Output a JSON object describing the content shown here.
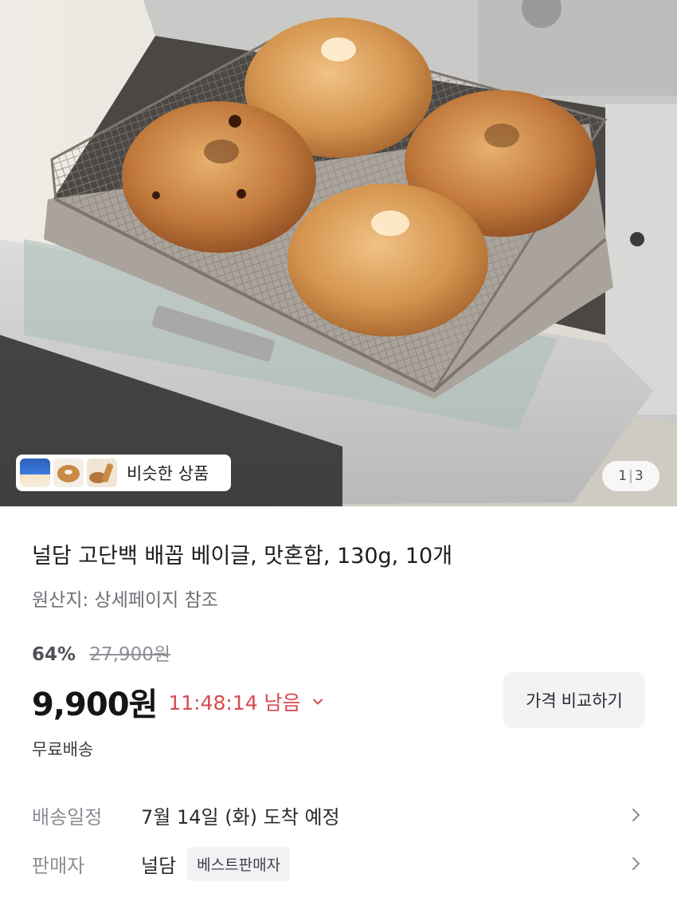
{
  "gallery": {
    "similar_label": "비슷한 상품",
    "counter_current": "1",
    "counter_sep": "|",
    "counter_total": "3"
  },
  "product": {
    "title": "널담 고단백 배꼽 베이글, 맛혼합, 130g, 10개",
    "origin": "원산지: 상세페이지 참조",
    "discount_rate": "64%",
    "original_price": "27,900원",
    "price": "9,900원",
    "timer": "11:48:14 남음",
    "compare_button": "가격 비교하기",
    "shipping_fee": "무료배송"
  },
  "details": {
    "delivery_label": "배송일정",
    "delivery_value": "7월 14일 (화) 도착 예정",
    "seller_label": "판매자",
    "seller_value": "널담",
    "seller_badge": "베스트판매자"
  },
  "colors": {
    "timer": "#d84a50",
    "background": "#ffffff",
    "button_bg": "#f2f3f5"
  },
  "icons": [
    "chevron-down-icon",
    "chevron-right-icon"
  ]
}
